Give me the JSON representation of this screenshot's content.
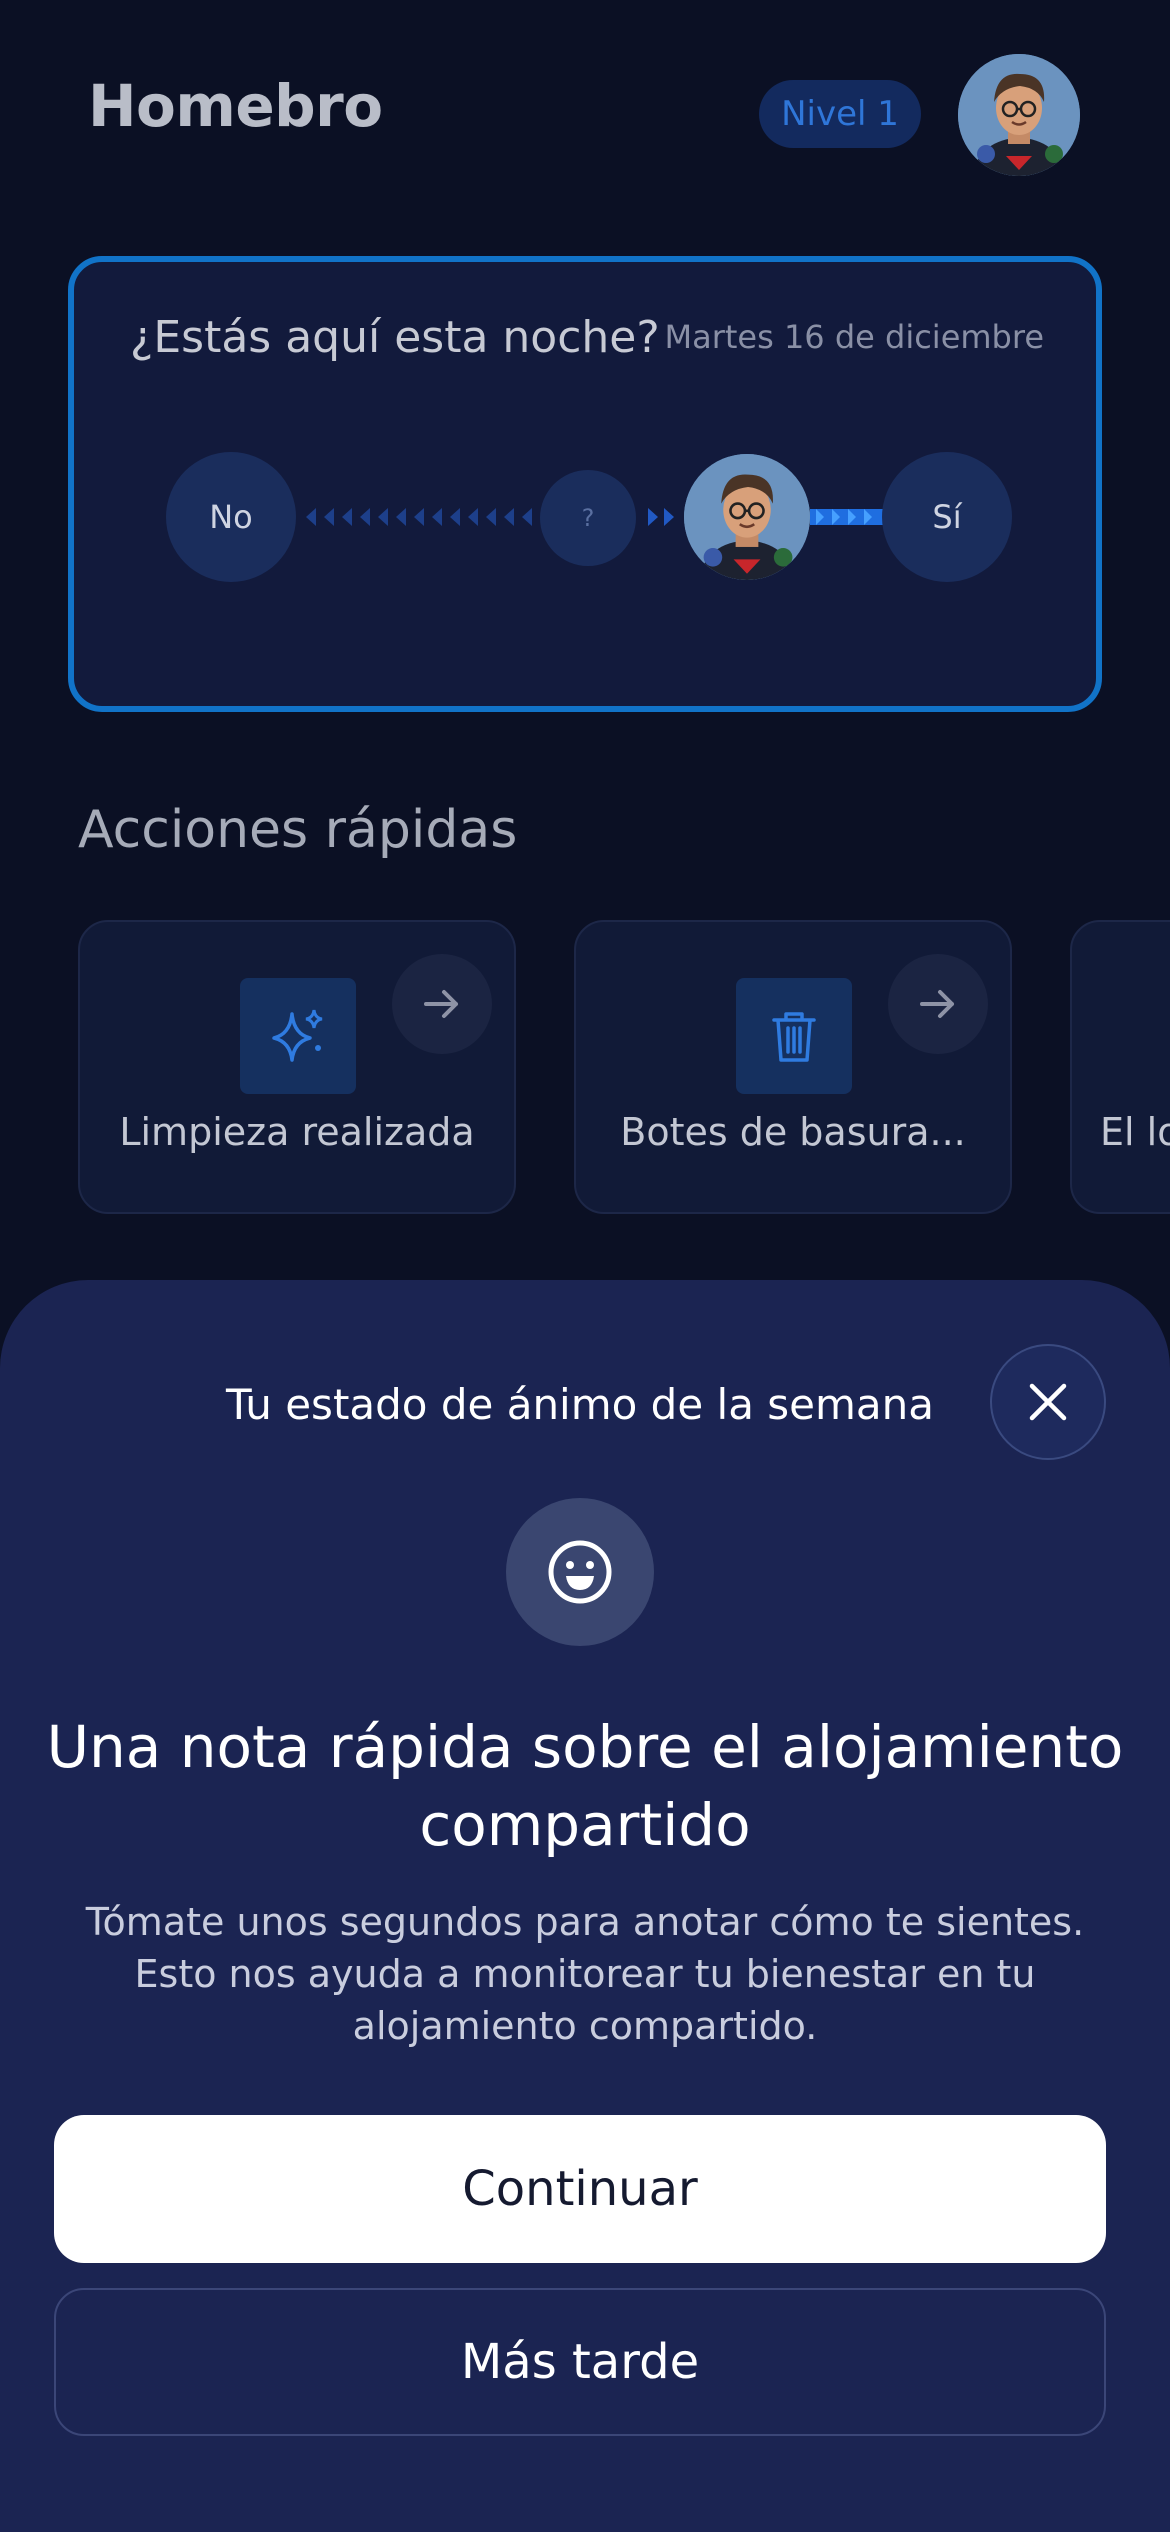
{
  "header": {
    "app_title": "Homebro",
    "level_badge": "Nivel 1",
    "avatar_icon": "user-avatar"
  },
  "presence_card": {
    "question": "¿Estás aquí esta noche?",
    "date": "Martes 16 de diciembre",
    "option_no": "No",
    "option_unknown": "?",
    "option_yes": "Sí"
  },
  "quick_actions": {
    "title": "Acciones rápidas",
    "items": [
      {
        "label": "Limpieza realizada",
        "icon": "sparkles-icon"
      },
      {
        "label": "Botes de basura...",
        "icon": "trash-icon"
      },
      {
        "label": "El lo",
        "icon": "unknown"
      }
    ]
  },
  "mood_sheet": {
    "title": "Tu estado de ánimo de la semana",
    "heading": "Una nota rápida sobre el alojamiento compartido",
    "description": "Tómate unos segundos para anotar cómo te sientes. Esto nos ayuda a monitorear tu bienestar en tu alojamiento compartido.",
    "continue_label": "Continuar",
    "later_label": "Más tarde"
  },
  "colors": {
    "background": "#0b1024",
    "accent": "#1173c8",
    "sheet": "#1b2452"
  }
}
